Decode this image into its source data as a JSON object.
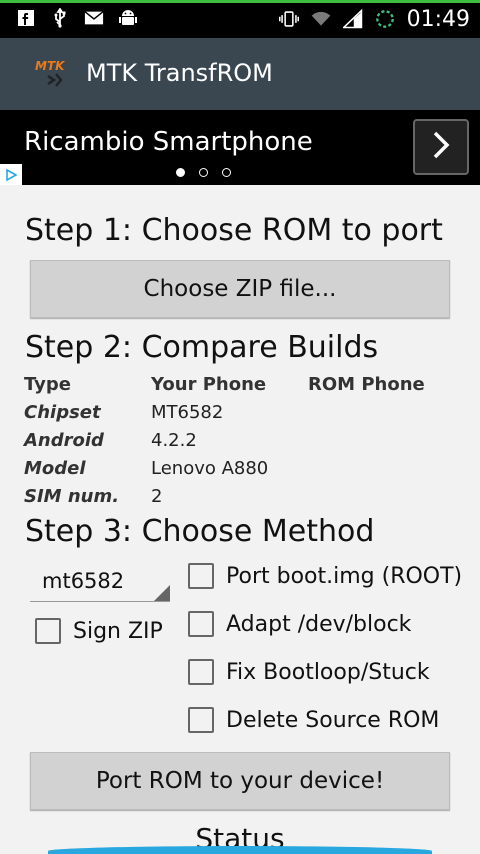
{
  "status_bar": {
    "time": "01:49",
    "icons_left": [
      "facebook-icon",
      "usb-icon",
      "mail-icon",
      "android-debug-icon"
    ],
    "icons_right": [
      "vibrate-icon",
      "wifi-icon",
      "signal-icon",
      "sync-icon"
    ]
  },
  "app": {
    "title": "MTK TransfROM",
    "logo_text": "MTK"
  },
  "ad": {
    "text": "Ricambio Smartphone",
    "dots": 3,
    "active_dot": 0
  },
  "step1": {
    "title": "Step 1: Choose ROM to port",
    "button": "Choose ZIP file..."
  },
  "step2": {
    "title": "Step 2: Compare Builds",
    "headers": [
      "Type",
      "Your Phone",
      "ROM Phone"
    ],
    "rows": [
      {
        "type": "Chipset",
        "your": "MT6582",
        "rom": ""
      },
      {
        "type": "Android",
        "your": "4.2.2",
        "rom": ""
      },
      {
        "type": "Model",
        "your": "Lenovo A880",
        "rom": ""
      },
      {
        "type": "SIM num.",
        "your": "2",
        "rom": ""
      }
    ]
  },
  "step3": {
    "title": "Step 3: Choose Method",
    "method_select": "mt6582",
    "sign_zip": "Sign ZIP",
    "options": [
      "Port boot.img (ROOT)",
      "Adapt /dev/block",
      "Fix Bootloop/Stuck",
      "Delete Source ROM"
    ],
    "button": "Port ROM to your device!"
  },
  "status": {
    "title": "Status"
  },
  "colors": {
    "actionbar": "#3a4750",
    "accent": "#29a8e0",
    "button": "#d2d2d2"
  }
}
